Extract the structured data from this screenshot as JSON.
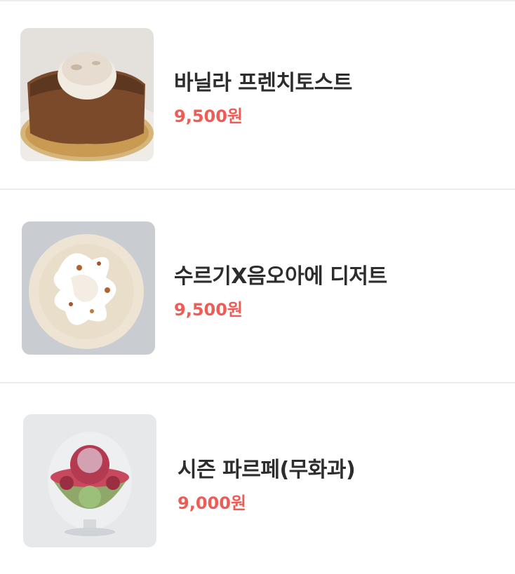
{
  "menu": {
    "items": [
      {
        "name": "바닐라 프렌치토스트",
        "price": "9,500원"
      },
      {
        "name": "수르기X음오아에 디저트",
        "price": "9,500원"
      },
      {
        "name": "시즌 파르페(무화과)",
        "price": "9,000원"
      }
    ]
  }
}
